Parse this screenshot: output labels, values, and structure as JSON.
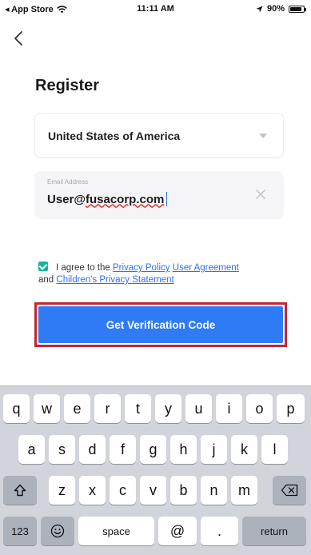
{
  "status_bar": {
    "back_label": "◂ App Store",
    "time": "11:11 AM",
    "battery": "90%",
    "battery_level": 0.9
  },
  "page": {
    "title": "Register"
  },
  "country": {
    "value": "United States of America"
  },
  "email": {
    "label": "Email Address",
    "value_user": "User@",
    "value_domain": "fusacorp.com"
  },
  "agreement": {
    "prefix": "I agree to the",
    "privacy_policy": "Privacy Policy",
    "user_agreement": "User Agreement",
    "and": "and",
    "childrens_privacy": "Children's Privacy Statement"
  },
  "cta": {
    "label": "Get Verification Code"
  },
  "keyboard": {
    "row1": [
      "q",
      "w",
      "e",
      "r",
      "t",
      "y",
      "u",
      "i",
      "o",
      "p"
    ],
    "row2": [
      "a",
      "s",
      "d",
      "f",
      "g",
      "h",
      "j",
      "k",
      "l"
    ],
    "row3": [
      "z",
      "x",
      "c",
      "v",
      "b",
      "n",
      "m"
    ],
    "numbers": "123",
    "space": "space",
    "at": "@",
    "period": ".",
    "return": "return"
  }
}
